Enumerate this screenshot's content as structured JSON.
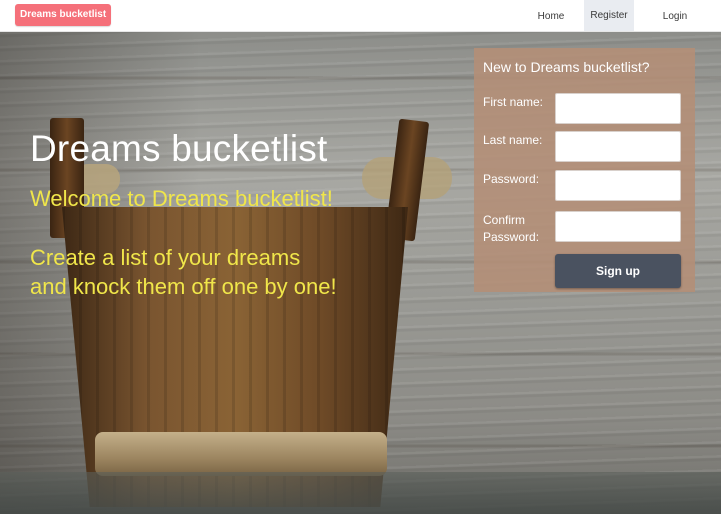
{
  "navbar": {
    "brand": "Dreams bucketlist",
    "links": [
      "Home",
      "Register",
      "Login"
    ],
    "active": "Register"
  },
  "hero": {
    "title": "Dreams bucketlist",
    "welcome": "Welcome to Dreams bucketlist!",
    "tagline_line1": "Create a list of your dreams",
    "tagline_line2": "and knock them off one by one!"
  },
  "signup": {
    "heading": "New to Dreams bucketlist?",
    "first_name_label": "First name:",
    "last_name_label": "Last name:",
    "password_label": "Password:",
    "confirm_label_line1": "Confirm",
    "confirm_label_line2": "Password:",
    "first_name_value": "",
    "last_name_value": "",
    "password_value": "",
    "confirm_value": "",
    "button_label": "Sign up"
  },
  "colors": {
    "brand_bg": "#f5707a",
    "accent_text": "#f0e64a",
    "panel_bg": "#b48e76",
    "button_bg": "#4a5260"
  }
}
